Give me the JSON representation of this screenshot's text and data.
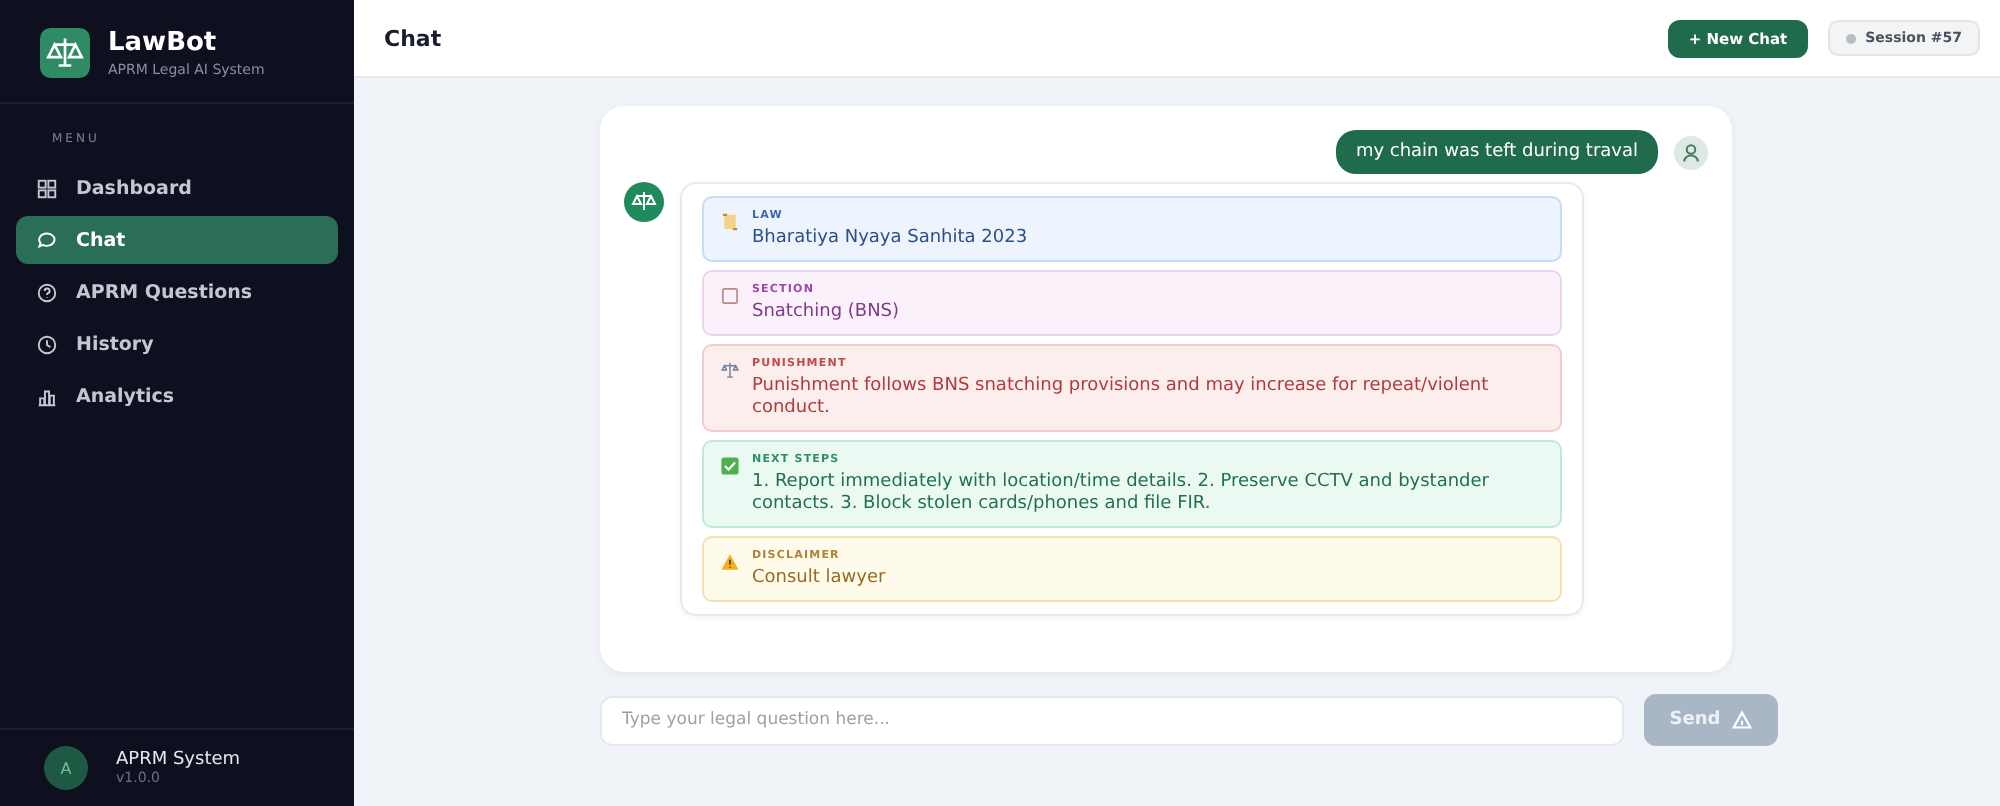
{
  "brand": {
    "name": "LawBot",
    "subtitle": "APRM Legal AI System"
  },
  "menu_label": "MENU",
  "sidebar": {
    "items": [
      {
        "label": "Dashboard",
        "selected": false
      },
      {
        "label": "Chat",
        "selected": true
      },
      {
        "label": "APRM Questions",
        "selected": false
      },
      {
        "label": "History",
        "selected": false
      },
      {
        "label": "Analytics",
        "selected": false
      }
    ]
  },
  "user": {
    "avatar": "A",
    "name": "APRM System",
    "version": "v1.0.0"
  },
  "header": {
    "title": "Chat",
    "new_chat": "+ New Chat",
    "session": "Session #57"
  },
  "user_message": "my chain was teft during traval",
  "response": [
    {
      "kind": "law",
      "label": "LAW",
      "text": "Bharatiya Nyaya Sanhita 2023"
    },
    {
      "kind": "section",
      "label": "SECTION",
      "text": "Snatching (BNS)"
    },
    {
      "kind": "punishment",
      "label": "PUNISHMENT",
      "text": "Punishment follows BNS snatching provisions and may increase for repeat/violent conduct."
    },
    {
      "kind": "steps",
      "label": "NEXT STEPS",
      "text": "1. Report immediately with location/time details. 2. Preserve CCTV and bystander contacts. 3. Block stolen cards/phones and file FIR."
    },
    {
      "kind": "disclaimer",
      "label": "DISCLAIMER",
      "text": "Consult lawyer"
    }
  ],
  "input": {
    "placeholder": "Type your legal question here..."
  },
  "send_button": {
    "label": "Send",
    "disabled": true
  }
}
